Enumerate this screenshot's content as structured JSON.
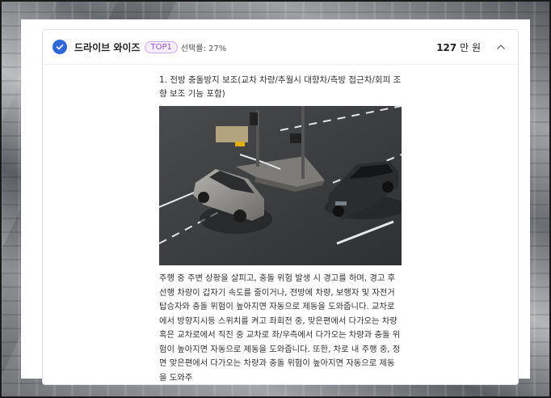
{
  "option": {
    "title": "드라이브 와이즈",
    "badge": "TOP1",
    "selection_rate": "선택률: 27%",
    "price_amount": "127",
    "price_unit": "만 원",
    "check_color": "#2e67d6"
  },
  "feature": {
    "title": "1. 전방 충돌방지 보조(교차 차량/추월시 대향차/측방 접근차/회피 조향 보조 기능 포함)",
    "image_icon": "road-intersection-photo",
    "description": "주행 중 주변 상황을 살피고, 충돌 위험 발생 시 경고를 하며, 경고 후 선행 차량이 갑자기 속도를 줄이거나, 전방에 차량, 보행자 및 자전거 탑승자와 충돌 위험이 높아지면 자동으로 제동을 도와줍니다. 교차로에서 방향지시등 스위치를 켜고 좌회전 중, 맞은편에서 다가오는 차량 혹은 교차로에서 직진 중 교차로 좌/우측에서 다가오는 차량과 충돌 위험이 높아지면 자동으로 제동을 도와줍니다. 또한, 차로 내 주행 중, 정면 맞은편에서 다가오는 차량과 충돌 위험이 높아지면 자동으로 제동을 도와주"
  }
}
